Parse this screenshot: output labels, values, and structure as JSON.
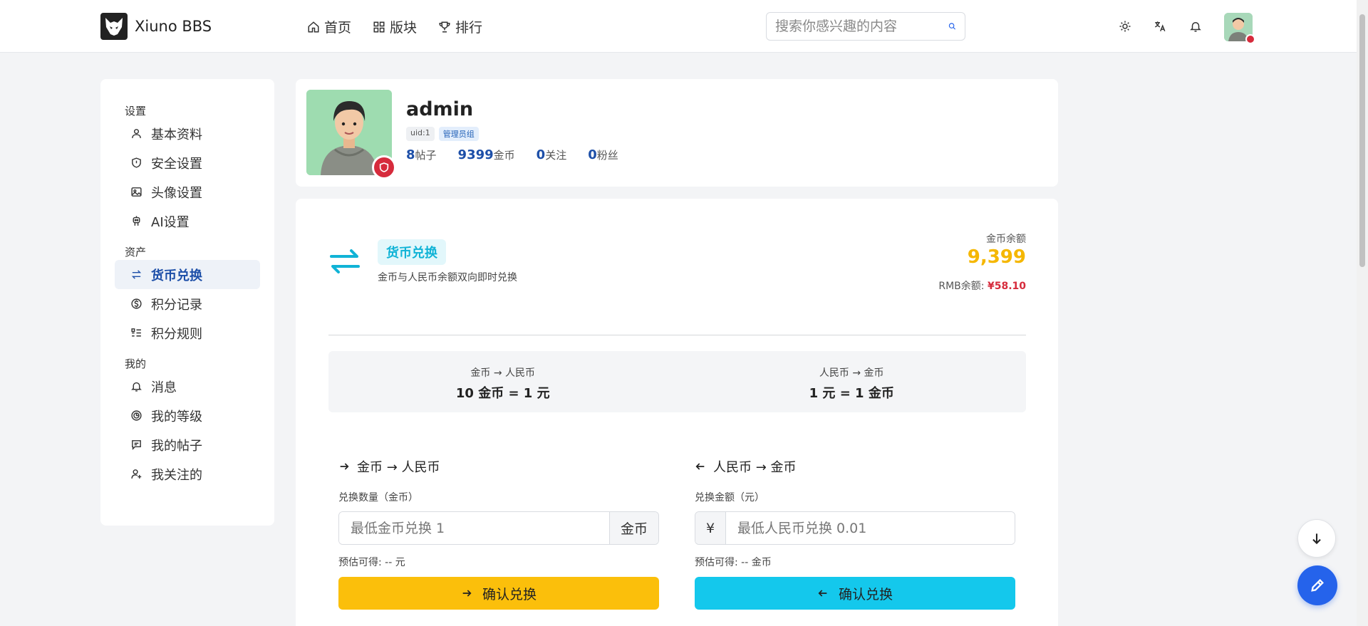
{
  "header": {
    "logo_text": "Xiuno BBS",
    "nav": [
      {
        "label": "首页",
        "icon": "home-icon"
      },
      {
        "label": "版块",
        "icon": "grid-icon"
      },
      {
        "label": "排行",
        "icon": "trophy-icon"
      }
    ],
    "search_placeholder": "搜索你感兴趣的内容"
  },
  "sidebar": {
    "groups": [
      {
        "title": "设置",
        "items": [
          "基本资料",
          "安全设置",
          "头像设置",
          "AI设置"
        ]
      },
      {
        "title": "资产",
        "items": [
          "货币兑换",
          "积分记录",
          "积分规则"
        ]
      },
      {
        "title": "我的",
        "items": [
          "消息",
          "我的等级",
          "我的帖子",
          "我关注的"
        ]
      }
    ],
    "active_item": "货币兑换"
  },
  "profile": {
    "username": "admin",
    "uid_badge": "uid:1",
    "group_badge": "管理员组",
    "stats": [
      {
        "value": "8",
        "label": "帖子"
      },
      {
        "value": "9399",
        "label": "金币"
      },
      {
        "value": "0",
        "label": "关注"
      },
      {
        "value": "0",
        "label": "粉丝"
      }
    ]
  },
  "exchange": {
    "title": "货币兑换",
    "description": "金币与人民币余额双向即时兑换",
    "balance_label": "金币余额",
    "balance_value": "9,399",
    "rmb_label": "RMB余额:",
    "rmb_value": "¥58.10",
    "rates": [
      {
        "label": "金币 → 人民币",
        "value": "10 金币 = 1 元"
      },
      {
        "label": "人民币 → 金币",
        "value": "1 元 = 1 金币"
      }
    ],
    "left_panel": {
      "title": "金币 → 人民币",
      "field_label": "兑换数量（金币）",
      "placeholder": "最低金币兑换 1",
      "addon": "金币",
      "estimate": "预估可得: -- 元",
      "button": "确认兑换"
    },
    "right_panel": {
      "title": "人民币 → 金币",
      "field_label": "兑换金额（元）",
      "placeholder": "最低人民币兑换 0.01",
      "addon": "¥",
      "estimate": "预估可得: -- 金币",
      "button": "确认兑换"
    }
  },
  "colors": {
    "accent_blue": "#1d4fa8",
    "gold": "#fbbf0b",
    "cyan": "#14c8ec",
    "danger": "#d62b3c"
  }
}
